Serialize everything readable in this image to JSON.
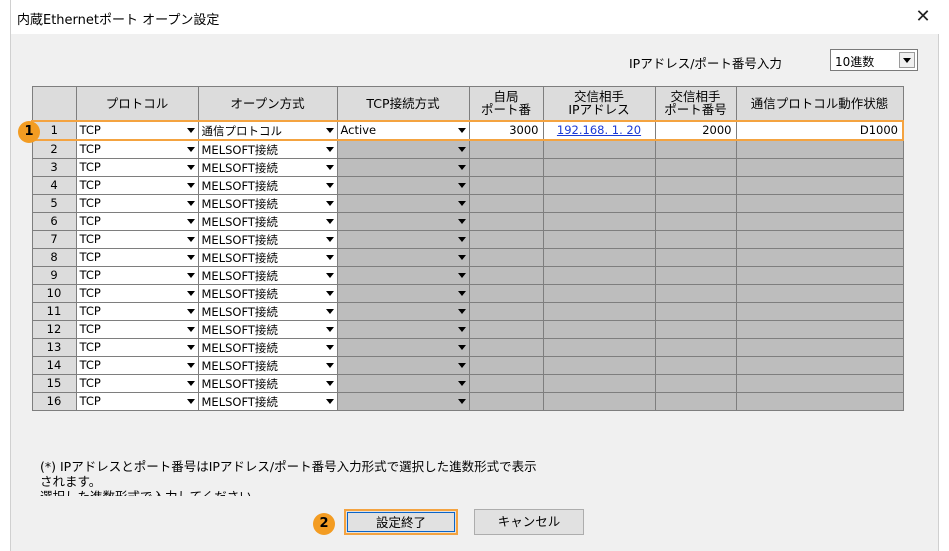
{
  "window": {
    "title": "内蔵Ethernetポート オープン設定",
    "close_glyph": "✕"
  },
  "ip_input": {
    "label": "IPアドレス/ポート番号入力",
    "value": "10進数"
  },
  "table": {
    "headers": {
      "no": "",
      "protocol": "プロトコル",
      "open_method": "オープン方式",
      "tcp_method": "TCP接続方式",
      "own_port": "自局\nポート番",
      "remote_ip": "交信相手\nIPアドレス",
      "remote_port": "交信相手\nポート番号",
      "status": "通信プロトコル動作状態"
    },
    "rows": [
      {
        "no": "1",
        "protocol": "TCP",
        "open_method": "通信プロトコル",
        "tcp_method": "Active",
        "own_port": "3000",
        "remote_ip": "192.168.  1. 20",
        "remote_port": "2000",
        "status": "D1000"
      },
      {
        "no": "2",
        "protocol": "TCP",
        "open_method": "MELSOFT接続"
      },
      {
        "no": "3",
        "protocol": "TCP",
        "open_method": "MELSOFT接続"
      },
      {
        "no": "4",
        "protocol": "TCP",
        "open_method": "MELSOFT接続"
      },
      {
        "no": "5",
        "protocol": "TCP",
        "open_method": "MELSOFT接続"
      },
      {
        "no": "6",
        "protocol": "TCP",
        "open_method": "MELSOFT接続"
      },
      {
        "no": "7",
        "protocol": "TCP",
        "open_method": "MELSOFT接続"
      },
      {
        "no": "8",
        "protocol": "TCP",
        "open_method": "MELSOFT接続"
      },
      {
        "no": "9",
        "protocol": "TCP",
        "open_method": "MELSOFT接続"
      },
      {
        "no": "10",
        "protocol": "TCP",
        "open_method": "MELSOFT接続"
      },
      {
        "no": "11",
        "protocol": "TCP",
        "open_method": "MELSOFT接続"
      },
      {
        "no": "12",
        "protocol": "TCP",
        "open_method": "MELSOFT接続"
      },
      {
        "no": "13",
        "protocol": "TCP",
        "open_method": "MELSOFT接続"
      },
      {
        "no": "14",
        "protocol": "TCP",
        "open_method": "MELSOFT接続"
      },
      {
        "no": "15",
        "protocol": "TCP",
        "open_method": "MELSOFT接続"
      },
      {
        "no": "16",
        "protocol": "TCP",
        "open_method": "MELSOFT接続"
      }
    ]
  },
  "note": {
    "line1": "(*) IPアドレスとポート番号はIPアドレス/ポート番号入力形式で選択した進数形式で表示",
    "line2": "されます。",
    "line3": "選択した進数形式で入力してください。"
  },
  "buttons": {
    "ok": "設定終了",
    "cancel": "キャンセル"
  },
  "callouts": {
    "one": "1",
    "two": "2"
  },
  "colors": {
    "highlight": "#f4a340",
    "badge": "#f39c22",
    "link": "#1a39d6"
  }
}
